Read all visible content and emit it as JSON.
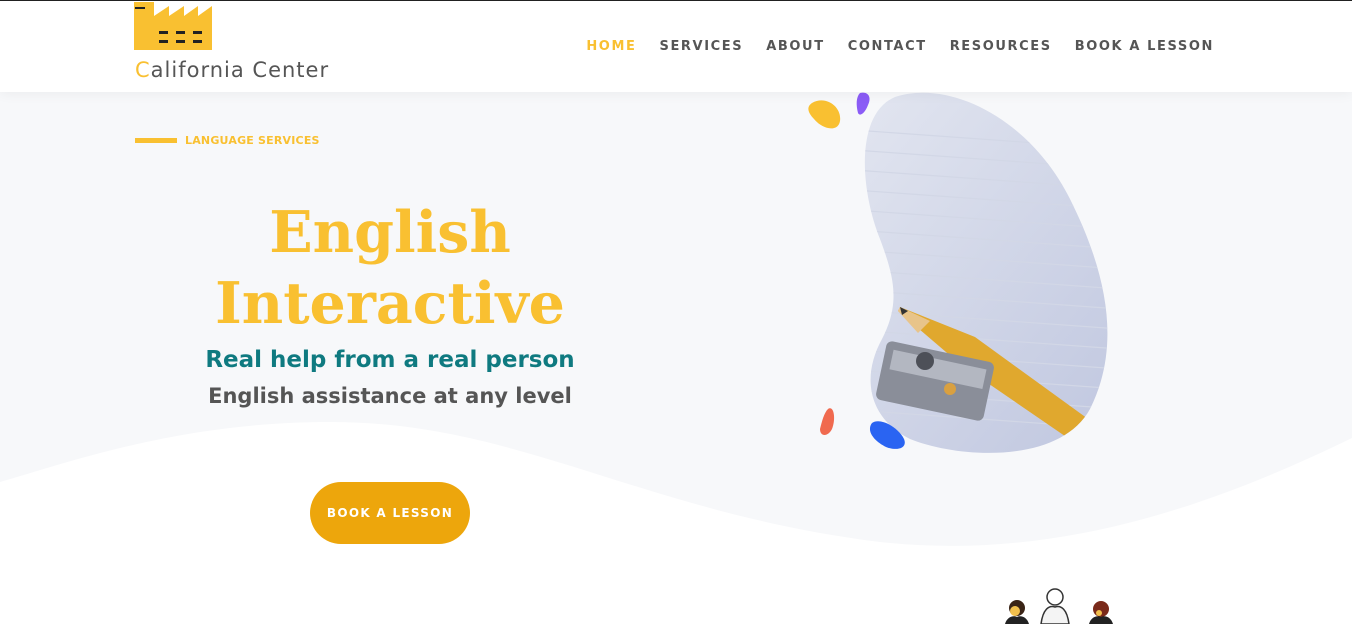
{
  "brand": {
    "logo_icon": "factory-icon",
    "first_letter": "C",
    "rest_name": "alifornia Center",
    "accent_color": "#f9c031"
  },
  "nav": {
    "items": [
      {
        "label": "HOME",
        "active": true
      },
      {
        "label": "SERVICES",
        "active": false
      },
      {
        "label": "ABOUT",
        "active": false
      },
      {
        "label": "CONTACT",
        "active": false
      },
      {
        "label": "RESOURCES",
        "active": false
      },
      {
        "label": "BOOK A LESSON",
        "active": false
      }
    ]
  },
  "hero": {
    "eyebrow": "LANGUAGE SERVICES",
    "title_line1": "English",
    "title_line2": "Interactive",
    "subtitle": "Real help from a real person",
    "tagline": "English assistance at any level",
    "cta_label": "BOOK A LESSON",
    "title_color": "#f9c031",
    "subtitle_color": "#0f7a80",
    "cta_color": "#eda60c"
  },
  "images": {
    "hero_image": "pencil-sharpener-photo",
    "bottom_illustration": "people-illustration"
  }
}
